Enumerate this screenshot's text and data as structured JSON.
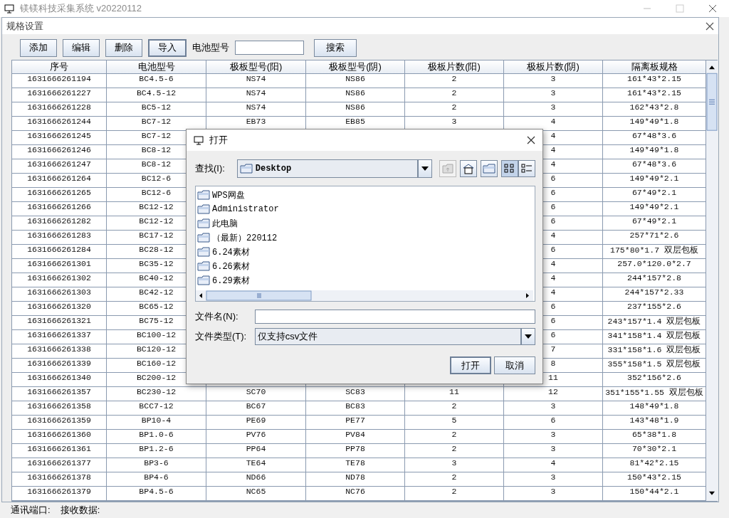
{
  "main_window": {
    "title": "镁镁科技采集系统 v20220112"
  },
  "spec_dialog": {
    "title": "规格设置",
    "toolbar": [
      {
        "label": "添加",
        "focused": false
      },
      {
        "label": "编辑",
        "focused": false
      },
      {
        "label": "删除",
        "focused": false
      },
      {
        "label": "导入",
        "focused": true
      }
    ],
    "search": {
      "label": "电池型号",
      "button": "搜索"
    },
    "table": {
      "columns": [
        "序号",
        "电池型号",
        "极板型号(阳)",
        "极板型号(阴)",
        "极板片数(阳)",
        "极板片数(阴)",
        "隔离板规格"
      ],
      "rows": [
        [
          "1631666261194",
          "BC4.5-6",
          "NS74",
          "NS86",
          "2",
          "3",
          "161*43*2.15"
        ],
        [
          "1631666261227",
          "BC4.5-12",
          "NS74",
          "NS86",
          "2",
          "3",
          "161*43*2.15"
        ],
        [
          "1631666261228",
          "BC5-12",
          "NS74",
          "NS86",
          "2",
          "3",
          "162*43*2.8"
        ],
        [
          "1631666261244",
          "BC7-12",
          "EB73",
          "EB85",
          "3",
          "4",
          "149*49*1.8"
        ],
        [
          "1631666261245",
          "BC7-12",
          null,
          null,
          null,
          "4",
          "67*48*3.6"
        ],
        [
          "1631666261246",
          "BC8-12",
          null,
          null,
          null,
          "4",
          "149*49*1.8"
        ],
        [
          "1631666261247",
          "BC8-12",
          null,
          null,
          null,
          "4",
          "67*48*3.6"
        ],
        [
          "1631666261264",
          "BC12-6",
          null,
          null,
          null,
          "6",
          "149*49*2.1"
        ],
        [
          "1631666261265",
          "BC12-6",
          null,
          null,
          null,
          "6",
          "67*49*2.1"
        ],
        [
          "1631666261266",
          "BC12-12",
          null,
          null,
          null,
          "6",
          "149*49*2.1"
        ],
        [
          "1631666261282",
          "BC12-12",
          null,
          null,
          null,
          "6",
          "67*49*2.1"
        ],
        [
          "1631666261283",
          "BC17-12",
          null,
          null,
          null,
          "4",
          "257*71*2.6"
        ],
        [
          "1631666261284",
          "BC28-12",
          null,
          null,
          null,
          "6",
          "175*80*1.7 双层包板"
        ],
        [
          "1631666261301",
          "BC35-12",
          null,
          null,
          null,
          "4",
          "257.0*120.0*2.7"
        ],
        [
          "1631666261302",
          "BC40-12",
          null,
          null,
          null,
          "4",
          "244*157*2.8"
        ],
        [
          "1631666261303",
          "BC42-12",
          null,
          null,
          null,
          "4",
          "244*157*2.33"
        ],
        [
          "1631666261320",
          "BC65-12",
          null,
          null,
          null,
          "6",
          "237*155*2.6"
        ],
        [
          "1631666261321",
          "BC75-12",
          null,
          null,
          null,
          "6",
          "243*157*1.4 双层包板"
        ],
        [
          "1631666261337",
          "BC100-12",
          null,
          null,
          null,
          "6",
          "341*158*1.4 双层包板"
        ],
        [
          "1631666261338",
          "BC120-12",
          null,
          null,
          null,
          "7",
          "331*158*1.6 双层包板"
        ],
        [
          "1631666261339",
          "BC160-12",
          null,
          null,
          null,
          "8",
          "355*158*1.5 双层包板"
        ],
        [
          "1631666261340",
          "BC200-12",
          null,
          null,
          null,
          "11",
          "352*156*2.6"
        ],
        [
          "1631666261357",
          "BC230-12",
          "SC70",
          "SC83",
          "11",
          "12",
          "351*155*1.55 双层包板"
        ],
        [
          "1631666261358",
          "BCC7-12",
          "BC67",
          "BC83",
          "2",
          "3",
          "148*49*1.8"
        ],
        [
          "1631666261359",
          "BP10-4",
          "PE69",
          "PE77",
          "5",
          "6",
          "143*48*1.9"
        ],
        [
          "1631666261360",
          "BP1.0-6",
          "PV76",
          "PV84",
          "2",
          "3",
          "65*38*1.8"
        ],
        [
          "1631666261361",
          "BP1.2-6",
          "PP64",
          "PP78",
          "2",
          "3",
          "70*30*2.1"
        ],
        [
          "1631666261377",
          "BP3-6",
          "TE64",
          "TE78",
          "3",
          "4",
          "81*42*2.15"
        ],
        [
          "1631666261378",
          "BP4-6",
          "ND66",
          "ND78",
          "2",
          "3",
          "150*43*2.15"
        ],
        [
          "1631666261379",
          "BP4.5-6",
          "NC65",
          "NC76",
          "2",
          "3",
          "150*44*2.1"
        ]
      ]
    }
  },
  "file_dialog": {
    "title": "打开",
    "look_in_label": "查找(I):",
    "location": "Desktop",
    "view_buttons": [
      {
        "kind": "list",
        "selected": true
      },
      {
        "kind": "details",
        "selected": false
      }
    ],
    "files": [
      "WPS网盘",
      "Administrator",
      "此电脑",
      "（最新）220112",
      "6.24素材",
      "6.26素材",
      "6.29素材"
    ],
    "file_name_label": "文件名(N):",
    "file_type_label": "文件类型(T):",
    "file_type": "仅支持csv文件",
    "buttons": [
      "打开",
      "取消"
    ]
  },
  "status_bar": {
    "items": [
      "通讯端口:",
      "接收数据:"
    ]
  }
}
